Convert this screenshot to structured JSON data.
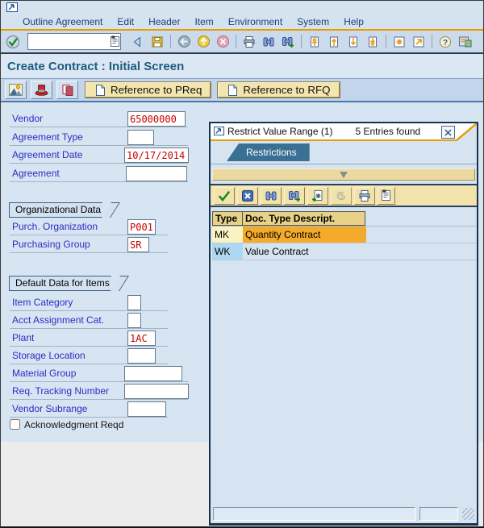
{
  "menu": {
    "items": [
      {
        "label": "Outline Agreement"
      },
      {
        "label": "Edit"
      },
      {
        "label": "Header"
      },
      {
        "label": "Item"
      },
      {
        "label": "Environment"
      },
      {
        "label": "System"
      },
      {
        "label": "Help"
      }
    ]
  },
  "toolbar": {
    "command_value": "",
    "icons": [
      "enter-icon",
      "command-list-icon",
      "back-triangle-icon",
      "save-icon",
      "back-circle-icon",
      "up-circle-icon",
      "cancel-circle-icon",
      "print-icon",
      "find-icon",
      "find-next-icon",
      "first-page-icon",
      "prev-page-icon",
      "next-page-icon",
      "last-page-icon",
      "new-session-icon",
      "shortcut-icon",
      "help-icon",
      "customize-icon"
    ]
  },
  "screen": {
    "title": "Create Contract : Initial Screen"
  },
  "app_toolbar": {
    "icons": [
      "overview-icon",
      "hat-icon",
      "copy-icon"
    ],
    "preq_button": "Reference to PReq",
    "rfq_button": "Reference to RFQ"
  },
  "form": {
    "vendor": {
      "label": "Vendor",
      "value": "65000000"
    },
    "agreement_type": {
      "label": "Agreement Type",
      "value": ""
    },
    "agreement_date": {
      "label": "Agreement Date",
      "value": "10/17/2014"
    },
    "agreement": {
      "label": "Agreement",
      "value": ""
    },
    "org_section": {
      "title": "Organizational Data",
      "purch_org": {
        "label": "Purch. Organization",
        "value": "P001"
      },
      "purch_group": {
        "label": "Purchasing Group",
        "value": "SR"
      }
    },
    "items_section": {
      "title": "Default Data for Items",
      "item_category": {
        "label": "Item Category",
        "value": ""
      },
      "acct_assignment": {
        "label": "Acct Assignment Cat.",
        "value": ""
      },
      "plant": {
        "label": "Plant",
        "value": "1AC"
      },
      "storage_location": {
        "label": "Storage Location",
        "value": ""
      },
      "material_group": {
        "label": "Material Group",
        "value": ""
      },
      "req_tracking": {
        "label": "Req. Tracking Number",
        "value": ""
      },
      "vendor_subrange": {
        "label": "Vendor Subrange",
        "value": ""
      },
      "acknowledgment": {
        "label": "Acknowledgment Reqd",
        "checked": false
      }
    }
  },
  "popup": {
    "title": "Restrict Value Range (1)",
    "entries": "5 Entries found",
    "tab_label": "Restrictions",
    "toolbar_icons": [
      "check-icon",
      "cancel-x-icon",
      "find-icon",
      "find-next-icon",
      "new-selection-icon",
      "help-disabled-icon",
      "print-icon",
      "list-icon"
    ],
    "table": {
      "columns": [
        {
          "label": "Type"
        },
        {
          "label": "Doc. Type Descript."
        }
      ],
      "rows": [
        {
          "type": "MK",
          "description": "Quantity Contract",
          "selected": true
        },
        {
          "type": "WK",
          "description": "Value Contract",
          "selected": false
        }
      ]
    }
  },
  "colors": {
    "accent_orange": "#e99b00",
    "selected_row": "#f4ab2c",
    "label_blue": "#2a2ec4",
    "value_red": "#c80000",
    "popup_tab_blue": "#3a7094",
    "window_bg": "#d5e2f0",
    "table_header": "#e6d186"
  }
}
